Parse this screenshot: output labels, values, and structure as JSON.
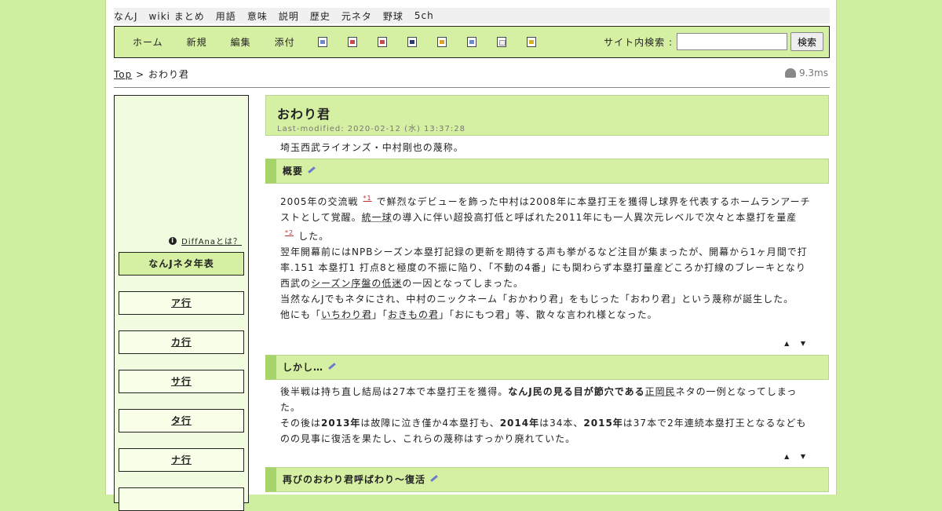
{
  "topnav": [
    "なんJ",
    "wiki まとめ",
    "用語",
    "意味",
    "説明",
    "歴史",
    "元ネタ",
    "野球",
    "5ch"
  ],
  "toolbar": {
    "links": [
      "ホーム",
      "新規",
      "編集",
      "添付"
    ],
    "icons": [
      "new-page-icon",
      "rename-icon",
      "delete-icon",
      "save-icon",
      "freeze-icon",
      "copy-icon",
      "list-icon",
      "help-icon"
    ]
  },
  "search": {
    "label": "サイト内検索 :",
    "value": "",
    "button": "検索"
  },
  "breadcrumb": {
    "top": "Top",
    "sep": ">",
    "current": "おわり君"
  },
  "timing": "9.3ms",
  "sidebar": {
    "diffana": "DiffAnaとは？",
    "items": [
      "なんJネタ年表",
      "ア行",
      "カ行",
      "サ行",
      "タ行",
      "ナ行"
    ]
  },
  "page": {
    "title": "おわり君",
    "last_modified": "Last-modified: 2020-02-12 (水) 13:37:28",
    "intro": "埼玉西武ライオンズ・中村剛也の蔑称。",
    "sections": [
      {
        "heading": "概要"
      },
      {
        "heading": "しかし…"
      },
      {
        "heading": "再びのおわり君呼ばわり～復活"
      }
    ],
    "s1": {
      "a1": "2005年の交流戦",
      "fn1": "*1",
      "a2": "で鮮烈なデビューを飾った中村は2008年に本塁打王を獲得し球界を代表するホームランアーチストとして覚醒。",
      "link_toitsu": "統一球",
      "a3": "の導入に伴い超投高打低と呼ばれた2011年にも一人異次元レベルで次々と本塁打を量産",
      "fn2": "*2",
      "a4": "した。",
      "p2": "翌年開幕前にはNPBシーズン本塁打記録の更新を期待する声も挙がるなど注目が集まったが、開幕から1ヶ月間で打率.151 本塁打1 打点8と極度の不振に陥り、「不動の4番」にも関わらず本塁打量産どころか打線のブレーキとなり西武の",
      "link_shiizun": "シーズン序盤の低迷",
      "p2_end": "の一因となってしまった。",
      "p3": "当然なんJでもネタにされ、中村のニックネーム「おかわり君」をもじった「おわり君」という蔑称が誕生した。",
      "p4_a": "他にも「",
      "link_ichi": "いちわり君",
      "p4_b": "」「",
      "link_okimono": "おきもの君",
      "p4_c": "」「おにもつ君」等、散々な言われ様となった。"
    },
    "s2": {
      "a1": "後半戦は持ち直し結局は27本で本塁打王を獲得。",
      "bold1": "なんJ民の見る目が節穴である",
      "link_seiko": "正岡民",
      "a2": "ネタの一例となってしまった。",
      "b1": "その後は",
      "y2013": "2013年",
      "b2": "は故障に泣き僅か4本塁打も、",
      "y2014": "2014年",
      "b3": "は34本、",
      "y2015": "2015年",
      "b4": "は37本で2年連続本塁打王となるなどものの見事に復活を果たし、これらの蔑称はすっかり廃れていた。"
    },
    "updown": "▲ ▼"
  }
}
